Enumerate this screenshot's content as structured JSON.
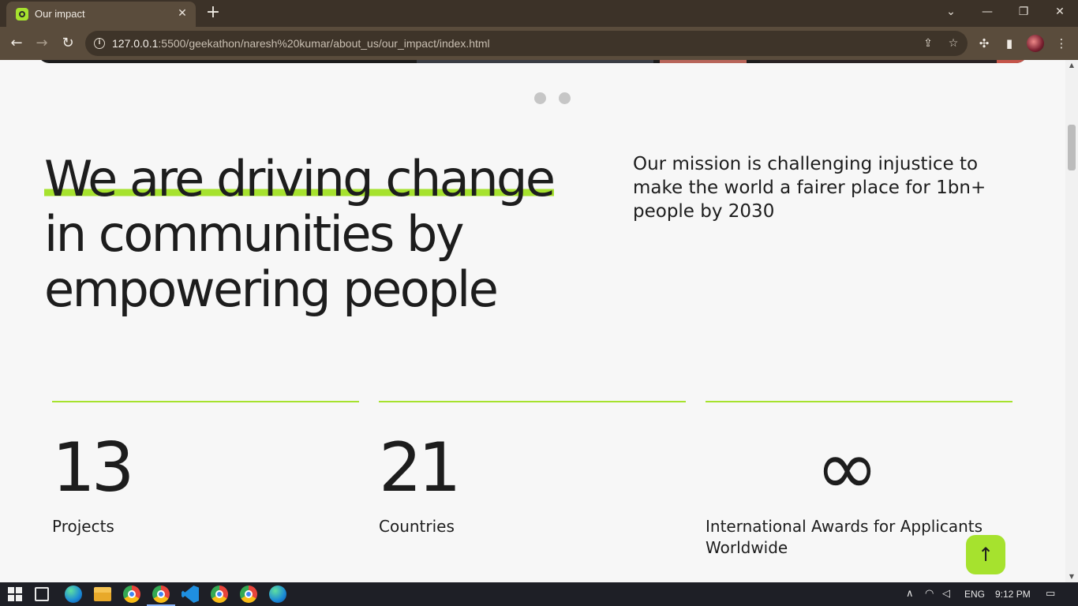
{
  "browser": {
    "tab_title": "Our impact",
    "tab_close": "✕",
    "new_tab": "+",
    "url_host": "127.0.0.1",
    "url_path": ":5500/geekathon/naresh%20kumar/about_us/our_impact/index.html",
    "window_controls": {
      "menu": "⌄",
      "minimize": "—",
      "restore": "❐",
      "close": "✕"
    },
    "nav": {
      "back": "←",
      "forward": "→",
      "reload": "↻"
    }
  },
  "page": {
    "headline_highlight": "We are driving change",
    "headline_rest": "in communities by empowering people",
    "mission": "Our mission is challenging injustice to make the world a fairer place for 1bn+ people by 2030",
    "stats": [
      {
        "number": "13",
        "label": "Projects"
      },
      {
        "number": "21",
        "label": "Countries"
      },
      {
        "number": "∞",
        "label": "International Awards for Applicants Worldwide"
      }
    ],
    "scroll_top_icon": "↑",
    "accent_color": "#a6e22e",
    "carousel_dots": 2
  },
  "taskbar": {
    "language": "ENG",
    "time": "9:12 PM"
  }
}
